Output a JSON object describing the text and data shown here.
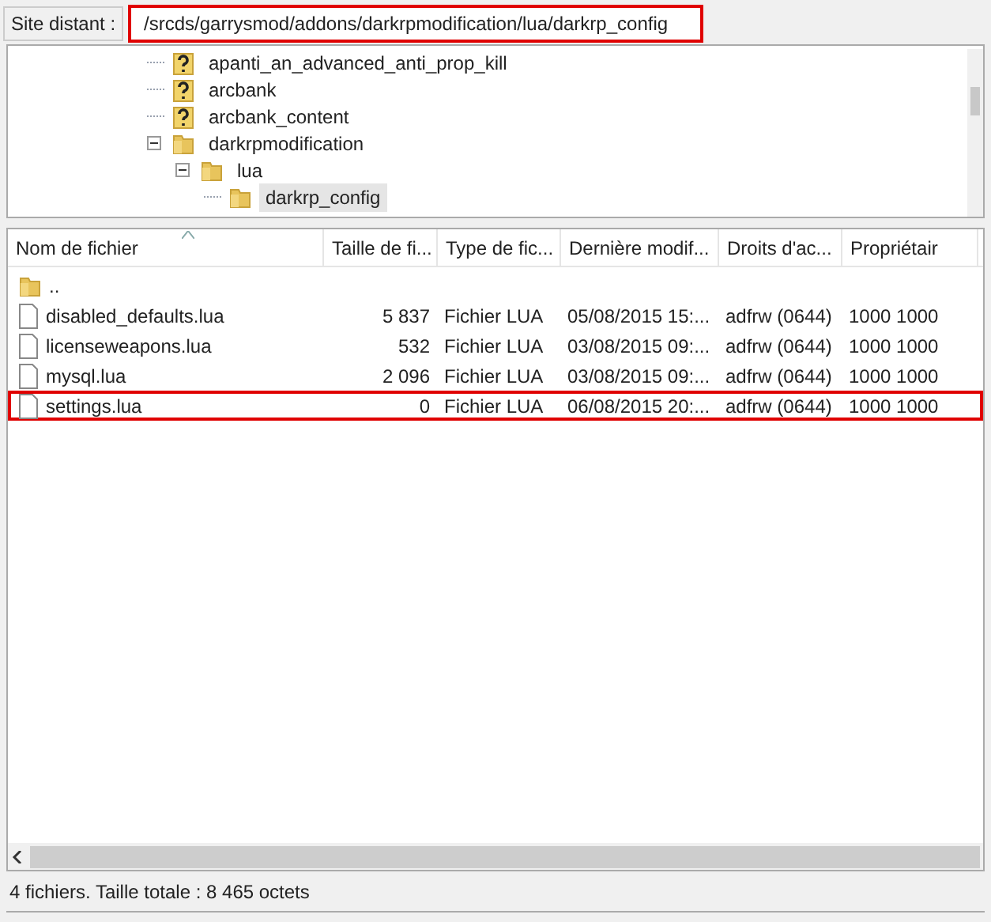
{
  "remote_site": {
    "label": "Site distant :",
    "path": "/srcds/garrysmod/addons/darkrpmodification/lua/darkrp_config",
    "highlighted": true
  },
  "tree": [
    {
      "name": "apanti_an_advanced_anti_prop_kill",
      "kind": "unknown",
      "selected": false
    },
    {
      "name": "arcbank",
      "kind": "unknown",
      "selected": false
    },
    {
      "name": "arcbank_content",
      "kind": "unknown",
      "selected": false
    },
    {
      "name": "darkrpmodification",
      "kind": "folder",
      "selected": false,
      "expanded": true,
      "children": [
        {
          "name": "lua",
          "kind": "folder",
          "selected": false,
          "expanded": true,
          "children": [
            {
              "name": "darkrp_config",
              "kind": "folder",
              "selected": true
            }
          ]
        }
      ]
    }
  ],
  "file_list": {
    "columns": [
      "Nom de fichier",
      "Taille de fi...",
      "Type de fic...",
      "Dernière modif...",
      "Droits d'ac...",
      "Propriétair"
    ],
    "rows": [
      {
        "kind": "folder",
        "cells": [
          ".."
        ],
        "highlighted": false
      },
      {
        "kind": "file",
        "cells": [
          "disabled_defaults.lua",
          "5 837",
          "Fichier LUA",
          "05/08/2015 15:...",
          "adfrw (0644)",
          "1000 1000"
        ],
        "highlighted": false
      },
      {
        "kind": "file",
        "cells": [
          "licenseweapons.lua",
          "532",
          "Fichier LUA",
          "03/08/2015 09:...",
          "adfrw (0644)",
          "1000 1000"
        ],
        "highlighted": false
      },
      {
        "kind": "file",
        "cells": [
          "mysql.lua",
          "2 096",
          "Fichier LUA",
          "03/08/2015 09:...",
          "adfrw (0644)",
          "1000 1000"
        ],
        "highlighted": false
      },
      {
        "kind": "file",
        "cells": [
          "settings.lua",
          "0",
          "Fichier LUA",
          "06/08/2015 20:...",
          "adfrw (0644)",
          "1000 1000"
        ],
        "highlighted": true
      }
    ]
  },
  "status_bar": "4 fichiers. Taille totale : 8 465 octets"
}
